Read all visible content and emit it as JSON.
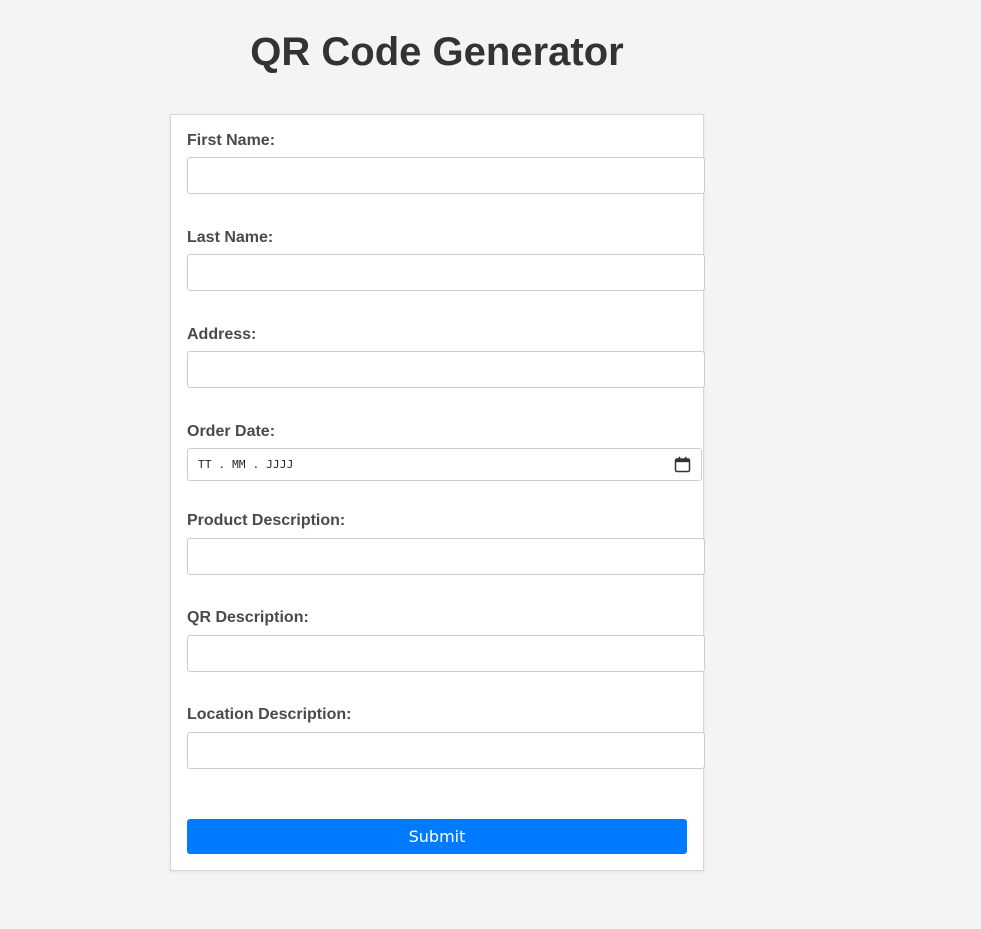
{
  "page": {
    "title": "QR Code Generator"
  },
  "form": {
    "first_name": {
      "label": "First Name:",
      "value": ""
    },
    "last_name": {
      "label": "Last Name:",
      "value": ""
    },
    "address": {
      "label": "Address:",
      "value": ""
    },
    "order_date": {
      "label": "Order Date:",
      "placeholder": "TT.MM.JJJJ"
    },
    "product_description": {
      "label": "Product Description:",
      "value": ""
    },
    "qr_description": {
      "label": "QR Description:",
      "value": ""
    },
    "location_description": {
      "label": "Location Description:",
      "value": ""
    },
    "submit_label": "Submit"
  },
  "colors": {
    "background": "#f4f4f4",
    "card": "#ffffff",
    "accent": "#007bff",
    "title_text": "#333333",
    "label_text": "#4a4a4a"
  },
  "icons": {
    "date_picker": "calendar-icon"
  }
}
